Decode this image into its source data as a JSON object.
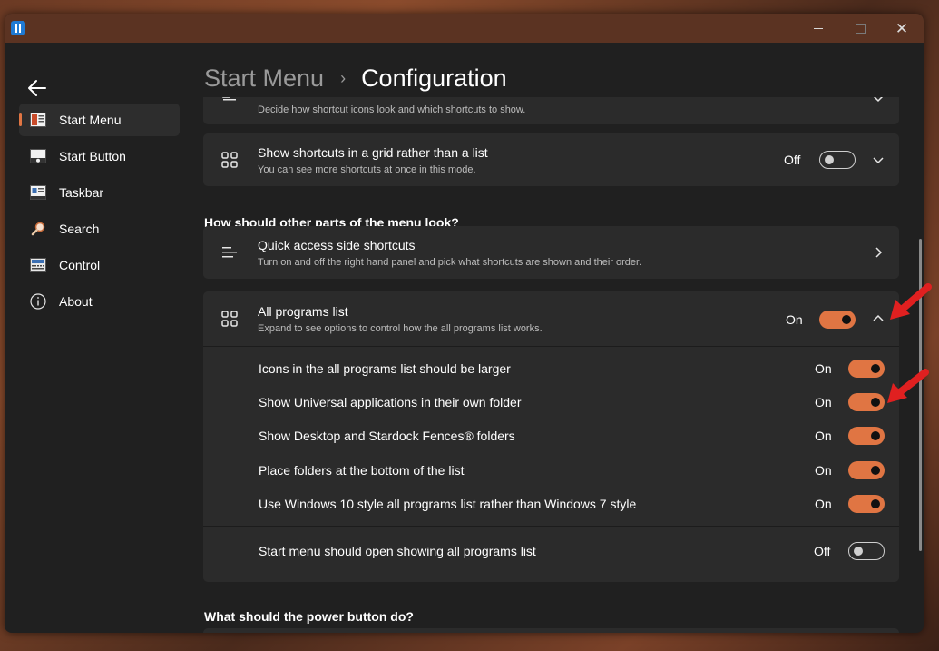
{
  "window": {
    "minimize_icon": "minimize-icon",
    "maximize_icon": "maximize-icon",
    "close_icon": "close-icon"
  },
  "sidebar": {
    "items": [
      {
        "label": "Start Menu",
        "icon": "start-menu-icon",
        "selected": true
      },
      {
        "label": "Start Button",
        "icon": "start-button-icon",
        "selected": false
      },
      {
        "label": "Taskbar",
        "icon": "taskbar-icon",
        "selected": false
      },
      {
        "label": "Search",
        "icon": "search-icon",
        "selected": false
      },
      {
        "label": "Control",
        "icon": "control-icon",
        "selected": false
      },
      {
        "label": "About",
        "icon": "info-icon",
        "selected": false
      }
    ]
  },
  "breadcrumb": {
    "parent": "Start Menu",
    "separator": "›",
    "current": "Configuration"
  },
  "cards": {
    "shortcut_icons": {
      "description": "Decide how shortcut icons look and which shortcuts to show."
    },
    "grid": {
      "title": "Show shortcuts in a grid rather than a list",
      "description": "You can see more shortcuts at once in this mode.",
      "state": "Off"
    },
    "quick_access": {
      "title": "Quick access side shortcuts",
      "description": "Turn on and off the right hand panel and pick what shortcuts are shown and their order."
    },
    "all_programs": {
      "title": "All programs list",
      "description": "Expand to see options to control how the all programs list works.",
      "state": "On",
      "options": [
        {
          "label": "Icons in the all programs list should be larger",
          "state": "On"
        },
        {
          "label": "Show Universal applications in their own folder",
          "state": "On"
        },
        {
          "label": "Show Desktop and Stardock Fences® folders",
          "state": "On"
        },
        {
          "label": "Place folders at the bottom of the list",
          "state": "On"
        },
        {
          "label": "Use Windows 10 style all programs list rather than Windows 7 style",
          "state": "On"
        },
        {
          "label": "Start menu should open showing all programs list",
          "state": "Off"
        }
      ]
    }
  },
  "sections": {
    "other_parts": "How should other parts of the menu look?",
    "power_button": "What should the power button do?"
  },
  "colors": {
    "accent": "#e07543",
    "window_bg": "#202020",
    "card_bg": "#2b2b2b",
    "titlebar_bg": "#5b3322",
    "annotation_arrow": "#e02020"
  }
}
